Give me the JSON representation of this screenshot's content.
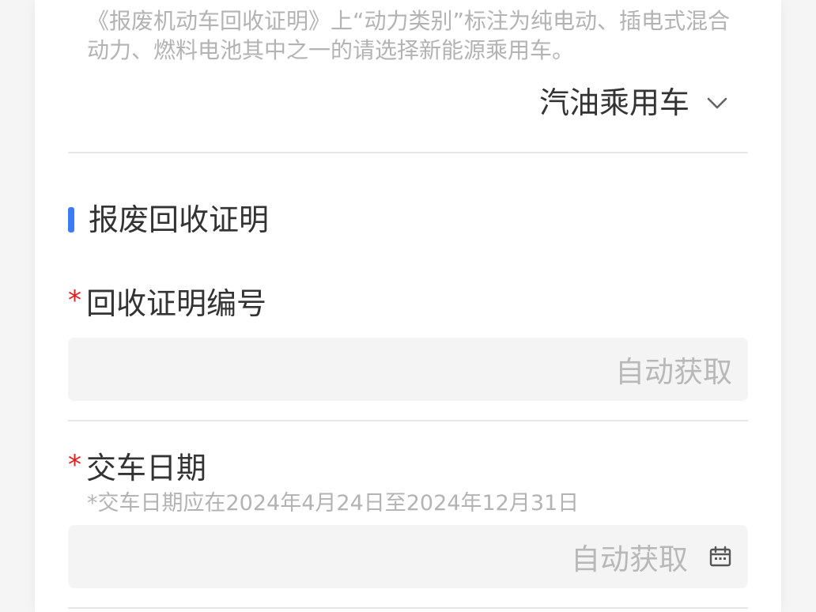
{
  "vehicle_type": {
    "hint": "《报废机动车回收证明》上“动力类别”标注为纯电动、插电式混合动力、燃料电池其中之一的请选择新能源乘用车。",
    "selected": "汽油乘用车"
  },
  "section": {
    "title": "报废回收证明"
  },
  "certificate_number": {
    "required_mark": "*",
    "label": "回收证明编号",
    "placeholder": "自动获取"
  },
  "delivery_date": {
    "required_mark": "*",
    "label": "交车日期",
    "hint": "*交车日期应在2024年4月24日至2024年12月31日",
    "placeholder": "自动获取"
  },
  "icons": {
    "dropdown": "chevron-down-icon",
    "date": "calendar-icon"
  },
  "colors": {
    "accent": "#3b7cf4",
    "required": "#e02020",
    "hint_text": "#b3b3b3",
    "input_bg": "#f4f4f4"
  }
}
